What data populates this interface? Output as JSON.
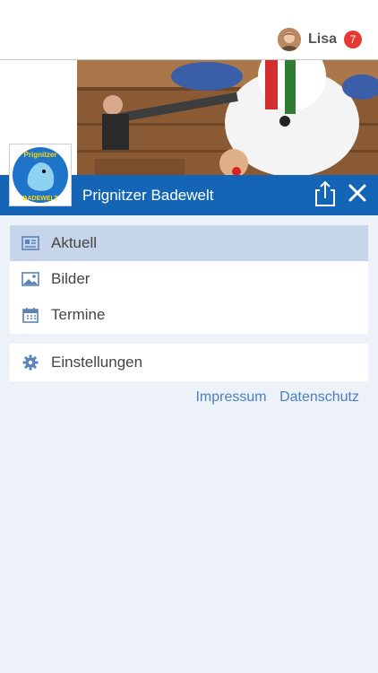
{
  "user": {
    "name": "Lisa",
    "notifications": "7"
  },
  "header": {
    "title": "Prignitzer Badewelt"
  },
  "logo": {
    "text_top": "Prignitzer",
    "text_bottom": "BADEWELT"
  },
  "menu": {
    "items": [
      {
        "label": "Aktuell",
        "icon": "newspaper-icon",
        "active": true
      },
      {
        "label": "Bilder",
        "icon": "image-icon",
        "active": false
      },
      {
        "label": "Termine",
        "icon": "calendar-icon",
        "active": false
      }
    ],
    "settings": {
      "label": "Einstellungen",
      "icon": "gear-icon"
    }
  },
  "footer": {
    "impressum": "Impressum",
    "datenschutz": "Datenschutz"
  },
  "colors": {
    "primary": "#1565b7",
    "active_bg": "#c6d5e9",
    "page_bg": "#edf2f9",
    "badge": "#e53935",
    "link": "#4a7ec2"
  }
}
